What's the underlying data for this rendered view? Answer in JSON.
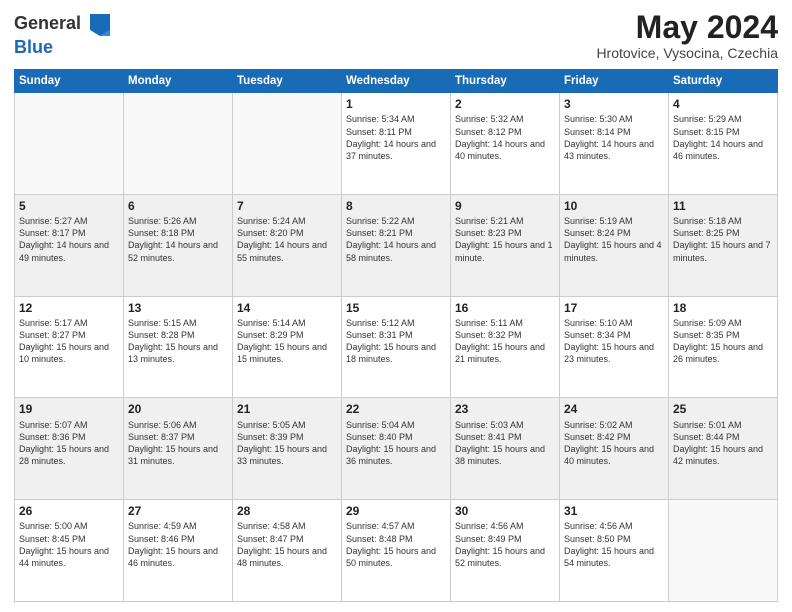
{
  "header": {
    "logo_line1": "General",
    "logo_line2": "Blue",
    "month_year": "May 2024",
    "location": "Hrotovice, Vysocina, Czechia"
  },
  "days_of_week": [
    "Sunday",
    "Monday",
    "Tuesday",
    "Wednesday",
    "Thursday",
    "Friday",
    "Saturday"
  ],
  "weeks": [
    [
      {
        "day": "",
        "sunrise": "",
        "sunset": "",
        "daylight": ""
      },
      {
        "day": "",
        "sunrise": "",
        "sunset": "",
        "daylight": ""
      },
      {
        "day": "",
        "sunrise": "",
        "sunset": "",
        "daylight": ""
      },
      {
        "day": "1",
        "sunrise": "Sunrise: 5:34 AM",
        "sunset": "Sunset: 8:11 PM",
        "daylight": "Daylight: 14 hours and 37 minutes."
      },
      {
        "day": "2",
        "sunrise": "Sunrise: 5:32 AM",
        "sunset": "Sunset: 8:12 PM",
        "daylight": "Daylight: 14 hours and 40 minutes."
      },
      {
        "day": "3",
        "sunrise": "Sunrise: 5:30 AM",
        "sunset": "Sunset: 8:14 PM",
        "daylight": "Daylight: 14 hours and 43 minutes."
      },
      {
        "day": "4",
        "sunrise": "Sunrise: 5:29 AM",
        "sunset": "Sunset: 8:15 PM",
        "daylight": "Daylight: 14 hours and 46 minutes."
      }
    ],
    [
      {
        "day": "5",
        "sunrise": "Sunrise: 5:27 AM",
        "sunset": "Sunset: 8:17 PM",
        "daylight": "Daylight: 14 hours and 49 minutes."
      },
      {
        "day": "6",
        "sunrise": "Sunrise: 5:26 AM",
        "sunset": "Sunset: 8:18 PM",
        "daylight": "Daylight: 14 hours and 52 minutes."
      },
      {
        "day": "7",
        "sunrise": "Sunrise: 5:24 AM",
        "sunset": "Sunset: 8:20 PM",
        "daylight": "Daylight: 14 hours and 55 minutes."
      },
      {
        "day": "8",
        "sunrise": "Sunrise: 5:22 AM",
        "sunset": "Sunset: 8:21 PM",
        "daylight": "Daylight: 14 hours and 58 minutes."
      },
      {
        "day": "9",
        "sunrise": "Sunrise: 5:21 AM",
        "sunset": "Sunset: 8:23 PM",
        "daylight": "Daylight: 15 hours and 1 minute."
      },
      {
        "day": "10",
        "sunrise": "Sunrise: 5:19 AM",
        "sunset": "Sunset: 8:24 PM",
        "daylight": "Daylight: 15 hours and 4 minutes."
      },
      {
        "day": "11",
        "sunrise": "Sunrise: 5:18 AM",
        "sunset": "Sunset: 8:25 PM",
        "daylight": "Daylight: 15 hours and 7 minutes."
      }
    ],
    [
      {
        "day": "12",
        "sunrise": "Sunrise: 5:17 AM",
        "sunset": "Sunset: 8:27 PM",
        "daylight": "Daylight: 15 hours and 10 minutes."
      },
      {
        "day": "13",
        "sunrise": "Sunrise: 5:15 AM",
        "sunset": "Sunset: 8:28 PM",
        "daylight": "Daylight: 15 hours and 13 minutes."
      },
      {
        "day": "14",
        "sunrise": "Sunrise: 5:14 AM",
        "sunset": "Sunset: 8:29 PM",
        "daylight": "Daylight: 15 hours and 15 minutes."
      },
      {
        "day": "15",
        "sunrise": "Sunrise: 5:12 AM",
        "sunset": "Sunset: 8:31 PM",
        "daylight": "Daylight: 15 hours and 18 minutes."
      },
      {
        "day": "16",
        "sunrise": "Sunrise: 5:11 AM",
        "sunset": "Sunset: 8:32 PM",
        "daylight": "Daylight: 15 hours and 21 minutes."
      },
      {
        "day": "17",
        "sunrise": "Sunrise: 5:10 AM",
        "sunset": "Sunset: 8:34 PM",
        "daylight": "Daylight: 15 hours and 23 minutes."
      },
      {
        "day": "18",
        "sunrise": "Sunrise: 5:09 AM",
        "sunset": "Sunset: 8:35 PM",
        "daylight": "Daylight: 15 hours and 26 minutes."
      }
    ],
    [
      {
        "day": "19",
        "sunrise": "Sunrise: 5:07 AM",
        "sunset": "Sunset: 8:36 PM",
        "daylight": "Daylight: 15 hours and 28 minutes."
      },
      {
        "day": "20",
        "sunrise": "Sunrise: 5:06 AM",
        "sunset": "Sunset: 8:37 PM",
        "daylight": "Daylight: 15 hours and 31 minutes."
      },
      {
        "day": "21",
        "sunrise": "Sunrise: 5:05 AM",
        "sunset": "Sunset: 8:39 PM",
        "daylight": "Daylight: 15 hours and 33 minutes."
      },
      {
        "day": "22",
        "sunrise": "Sunrise: 5:04 AM",
        "sunset": "Sunset: 8:40 PM",
        "daylight": "Daylight: 15 hours and 36 minutes."
      },
      {
        "day": "23",
        "sunrise": "Sunrise: 5:03 AM",
        "sunset": "Sunset: 8:41 PM",
        "daylight": "Daylight: 15 hours and 38 minutes."
      },
      {
        "day": "24",
        "sunrise": "Sunrise: 5:02 AM",
        "sunset": "Sunset: 8:42 PM",
        "daylight": "Daylight: 15 hours and 40 minutes."
      },
      {
        "day": "25",
        "sunrise": "Sunrise: 5:01 AM",
        "sunset": "Sunset: 8:44 PM",
        "daylight": "Daylight: 15 hours and 42 minutes."
      }
    ],
    [
      {
        "day": "26",
        "sunrise": "Sunrise: 5:00 AM",
        "sunset": "Sunset: 8:45 PM",
        "daylight": "Daylight: 15 hours and 44 minutes."
      },
      {
        "day": "27",
        "sunrise": "Sunrise: 4:59 AM",
        "sunset": "Sunset: 8:46 PM",
        "daylight": "Daylight: 15 hours and 46 minutes."
      },
      {
        "day": "28",
        "sunrise": "Sunrise: 4:58 AM",
        "sunset": "Sunset: 8:47 PM",
        "daylight": "Daylight: 15 hours and 48 minutes."
      },
      {
        "day": "29",
        "sunrise": "Sunrise: 4:57 AM",
        "sunset": "Sunset: 8:48 PM",
        "daylight": "Daylight: 15 hours and 50 minutes."
      },
      {
        "day": "30",
        "sunrise": "Sunrise: 4:56 AM",
        "sunset": "Sunset: 8:49 PM",
        "daylight": "Daylight: 15 hours and 52 minutes."
      },
      {
        "day": "31",
        "sunrise": "Sunrise: 4:56 AM",
        "sunset": "Sunset: 8:50 PM",
        "daylight": "Daylight: 15 hours and 54 minutes."
      },
      {
        "day": "",
        "sunrise": "",
        "sunset": "",
        "daylight": ""
      }
    ]
  ]
}
